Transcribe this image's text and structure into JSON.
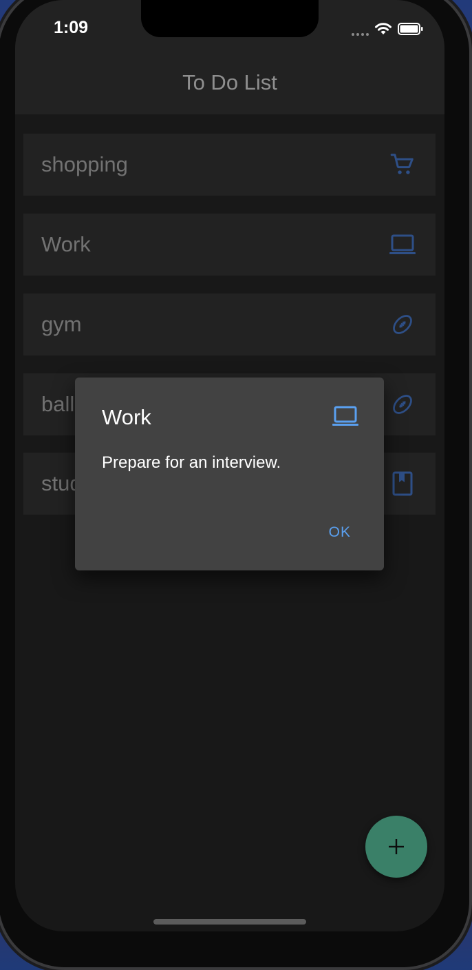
{
  "status_bar": {
    "time": "1:09"
  },
  "app_bar": {
    "title": "To Do List"
  },
  "todo_items": [
    {
      "label": "shopping",
      "icon": "shopping-cart-icon"
    },
    {
      "label": "Work",
      "icon": "laptop-icon"
    },
    {
      "label": "gym",
      "icon": "football-icon"
    },
    {
      "label": "ball",
      "icon": "football-icon"
    },
    {
      "label": "study",
      "icon": "book-icon"
    }
  ],
  "dialog": {
    "title": "Work",
    "title_icon": "laptop-icon",
    "body": "Prepare for an interview.",
    "ok_label": "OK"
  },
  "fab": {
    "icon": "plus-icon"
  },
  "colors": {
    "background": "#181818",
    "app_bar": "#222222",
    "list_item": "#222222",
    "list_text": "#727272",
    "icon_dim_blue": "#2e4f87",
    "dialog_bg": "#424242",
    "accent_blue": "#5aa0f0",
    "fab": "#3a8068"
  }
}
